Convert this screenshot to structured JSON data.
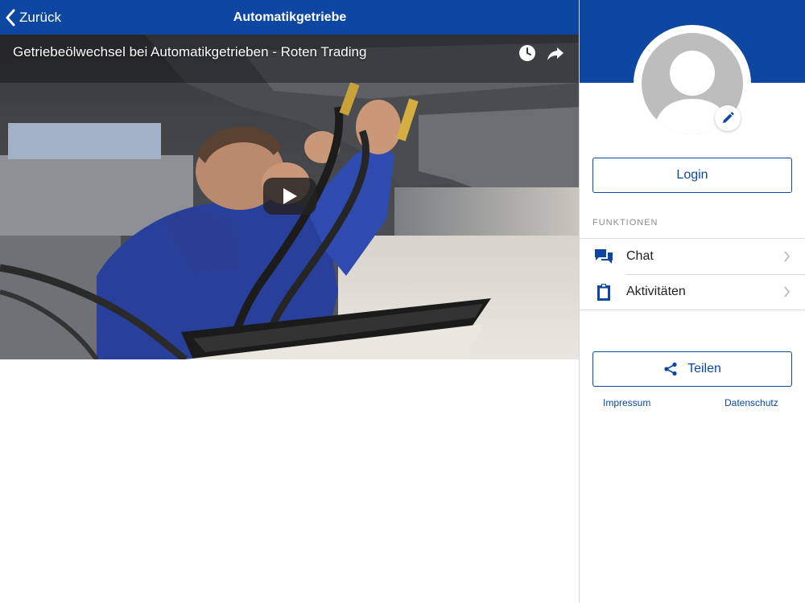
{
  "header": {
    "back_label": "Zurück",
    "title": "Automatikgetriebe",
    "color": "#0d47a1"
  },
  "video": {
    "title": "Getriebeölwechsel bei Automatikgetrieben - Roten Trading",
    "icons": [
      "clock-icon",
      "share-arrow-icon",
      "play-icon"
    ]
  },
  "profile": {
    "avatar": "default-user-avatar",
    "edit_icon": "pencil-icon"
  },
  "login_label": "Login",
  "functions": {
    "section_label": "FUNKTIONEN",
    "items": [
      {
        "label": "Chat",
        "icon": "chat-bubbles-icon"
      },
      {
        "label": "Aktivitäten",
        "icon": "clipboard-icon"
      }
    ]
  },
  "share_label": "Teilen",
  "footer": {
    "impressum": "Impressum",
    "datenschutz": "Datenschutz"
  }
}
